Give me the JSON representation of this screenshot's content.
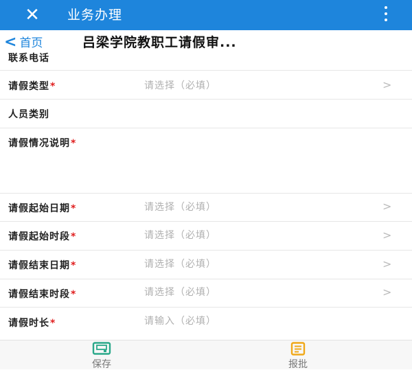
{
  "appbar": {
    "title": "业务办理",
    "close_icon": "close-icon",
    "more_icon": "more-vertical-icon",
    "color": "#1e85dc"
  },
  "nav": {
    "back_label": "首页",
    "title": "吕梁学院教职工请假审..."
  },
  "rows": [
    {
      "label": "联系电话",
      "required": false,
      "value": "",
      "arrow": false
    },
    {
      "label": "请假类型",
      "required": true,
      "value": "请选择（必填）",
      "arrow": true
    },
    {
      "label": "人员类别",
      "required": false,
      "value": "",
      "arrow": false
    },
    {
      "label": "请假情况说明",
      "required": true,
      "value": "",
      "arrow": false
    },
    {
      "label": "请假起始日期",
      "required": true,
      "value": "请选择（必填）",
      "arrow": true
    },
    {
      "label": "请假起始时段",
      "required": true,
      "value": "请选择（必填）",
      "arrow": true
    },
    {
      "label": "请假结束日期",
      "required": true,
      "value": "请选择（必填）",
      "arrow": true
    },
    {
      "label": "请假结束时段",
      "required": true,
      "value": "请选择（必填）",
      "arrow": true
    },
    {
      "label": "请假时长",
      "required": true,
      "value": "请输入（必填）",
      "arrow": false
    }
  ],
  "required_mark": "*",
  "arrow_glyph": ">",
  "bottom": {
    "save_label": "保存",
    "submit_label": "报批",
    "save_icon": "save-icon",
    "submit_icon": "document-icon",
    "save_color": "#2aa88a",
    "submit_color": "#f0a818"
  }
}
